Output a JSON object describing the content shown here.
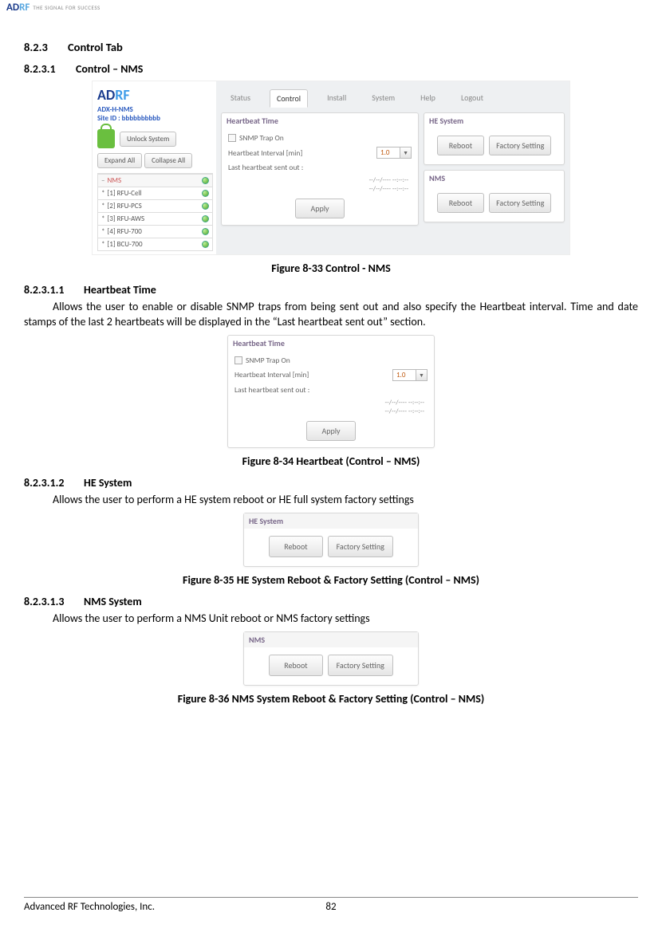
{
  "header_logo": {
    "ad": "AD",
    "rf": "RF",
    "tag": "THE SIGNAL FOR SUCCESS"
  },
  "sec_8_2_3": {
    "num": "8.2.3",
    "title": "Control Tab"
  },
  "sec_8_2_3_1": {
    "num": "8.2.3.1",
    "title": "Control – NMS"
  },
  "fig33": {
    "caption": "Figure 8-33    Control - NMS",
    "product": "ADX-H-NMS",
    "site_id": "Site ID : bbbbbbbbbb",
    "unlock": "Unlock System",
    "expand": "Expand All",
    "collapse": "Collapse All",
    "tree_root": "NMS",
    "tree_items": [
      "[1] RFU-Cell",
      "[2] RFU-PCS",
      "[3] RFU-AWS",
      "[4] RFU-700",
      "[1] BCU-700"
    ],
    "tabs": [
      "Status",
      "Control",
      "Install",
      "System",
      "Help",
      "Logout"
    ],
    "active_tab": "Control",
    "heartbeat": {
      "title": "Heartbeat Time",
      "snmp": "SNMP Trap On",
      "interval_label": "Heartbeat Interval [min]",
      "interval_value": "1.0",
      "last_label": "Last heartbeat sent out :",
      "line1": "--/--/---- --:--:--",
      "line2": "--/--/---- --:--:--",
      "apply": "Apply"
    },
    "he": {
      "title": "HE System",
      "reboot": "Reboot",
      "factory": "Factory Setting"
    },
    "nms": {
      "title": "NMS",
      "reboot": "Reboot",
      "factory": "Factory Setting"
    }
  },
  "sec_8_2_3_1_1": {
    "num": "8.2.3.1.1",
    "title": "Heartbeat Time",
    "body": "Allows the user to enable or disable SNMP traps from being sent out and also specify the Heartbeat interval. Time and date stamps of the last 2 heartbeats will be displayed in the “Last heartbeat sent out” section."
  },
  "fig34": {
    "caption": "Figure 8-34    Heartbeat (Control – NMS)"
  },
  "sec_8_2_3_1_2": {
    "num": "8.2.3.1.2",
    "title": "HE System",
    "body": "Allows the user to perform a HE system reboot or HE full system factory settings"
  },
  "fig35": {
    "caption": "Figure 8-35    HE System Reboot & Factory Setting (Control – NMS)"
  },
  "sec_8_2_3_1_3": {
    "num": "8.2.3.1.3",
    "title": "NMS System",
    "body": "Allows the user to perform a NMS Unit reboot or NMS factory settings"
  },
  "fig36": {
    "caption": "Figure 8-36    NMS System Reboot & Factory Setting (Control – NMS)"
  },
  "footer": {
    "company": "Advanced RF Technologies, Inc.",
    "page": "82"
  }
}
